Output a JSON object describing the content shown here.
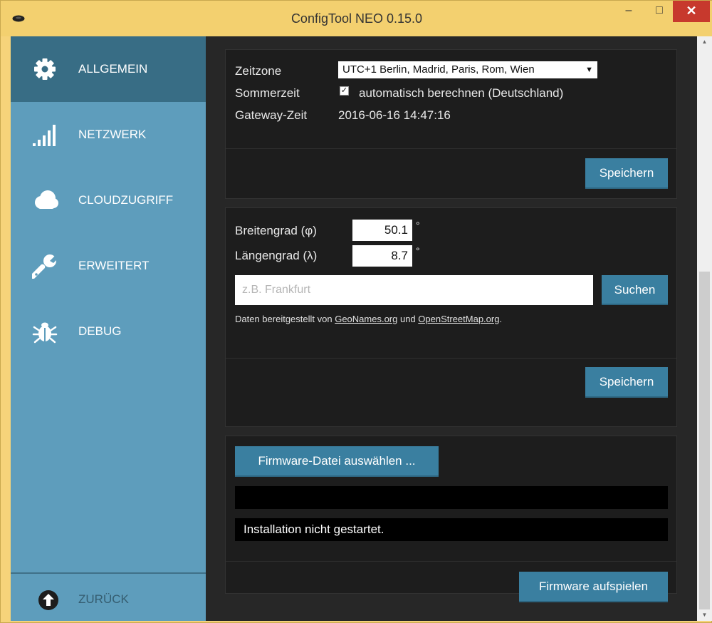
{
  "window": {
    "title": "ConfigTool NEO 0.15.0",
    "controls": {
      "minimize": "–",
      "maximize": "□",
      "close": "✕"
    }
  },
  "sidebar": {
    "items": [
      {
        "label": "ALLGEMEIN",
        "icon": "gear-icon",
        "active": true
      },
      {
        "label": "NETZWERK",
        "icon": "signal-bars-icon",
        "active": false
      },
      {
        "label": "CLOUDZUGRIFF",
        "icon": "cloud-icon",
        "active": false
      },
      {
        "label": "ERWEITERT",
        "icon": "wrench-icon",
        "active": false
      },
      {
        "label": "DEBUG",
        "icon": "bug-icon",
        "active": false
      }
    ],
    "back": {
      "label": "ZURÜCK",
      "icon": "arrow-up-circle-icon"
    }
  },
  "time_panel": {
    "timezone_label": "Zeitzone",
    "timezone_value": "UTC+1  Berlin, Madrid, Paris, Rom, Wien",
    "dst_label": "Sommerzeit",
    "dst_checked": true,
    "dst_option": "automatisch berechnen (Deutschland)",
    "gateway_time_label": "Gateway-Zeit",
    "gateway_time_value": "2016-06-16 14:47:16",
    "save_label": "Speichern"
  },
  "location_panel": {
    "latitude_label": "Breitengrad (φ)",
    "latitude_value": "50.1",
    "longitude_label": "Längengrad (λ)",
    "longitude_value": "8.7",
    "degree_symbol": "°",
    "search_placeholder": "z.B. Frankfurt",
    "search_label": "Suchen",
    "credit_prefix": "Daten bereitgestellt von ",
    "credit_link1": "GeoNames.org",
    "credit_middle": " und ",
    "credit_link2": "OpenStreetMap.org",
    "credit_suffix": ".",
    "save_label": "Speichern"
  },
  "firmware_panel": {
    "select_file_label": "Firmware-Datei auswählen ...",
    "file_name_value": "",
    "status_text": "Installation nicht gestartet.",
    "install_label": "Firmware aufspielen"
  },
  "colors": {
    "titlebar": "#f3d06f",
    "sidebar": "#5e9dbc",
    "sidebar_active": "#386d85",
    "button": "#3a7fa0",
    "panel": "#1d1d1d",
    "close_button": "#c7392d"
  }
}
